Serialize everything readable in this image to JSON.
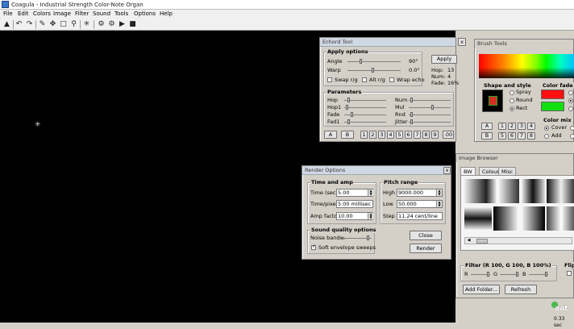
{
  "window": {
    "title": "Coagula - Industrial Strength Color-Note Organ"
  },
  "menu": [
    "File",
    "Edit",
    "Colors",
    "Image",
    "Filter",
    "Sound",
    "Tools",
    "Options",
    "Help"
  ],
  "toolbar_icons": [
    "save-icon",
    "undo-icon",
    "redo-icon",
    "pencil-icon",
    "move-icon",
    "crop-icon",
    "zoom-icon",
    "spray-icon",
    "settings-icon",
    "settings-icon",
    "play-icon",
    "stop-icon"
  ],
  "echord": {
    "title": "Echord Tool",
    "close": "x",
    "apply_group": "Apply options",
    "angle_label": "Angle",
    "angle_value": "90°",
    "warp_label": "Warp",
    "warp_value": "0.0°",
    "swap_label": "Swap r/g",
    "alt_label": "Alt r/g",
    "wrap_label": "Wrap echo",
    "apply_btn": "Apply",
    "hop_info": "Hop:",
    "hop_info_val": "13",
    "num_info": "Num:",
    "num_info_val": "4",
    "fade_info": "Fade:",
    "fade_info_val": "16%",
    "params_group": "Parameters",
    "params_left": [
      "Hop",
      "Hop1",
      "Fade",
      "Fad1"
    ],
    "params_right": [
      "Num",
      "Mul",
      "Rnd",
      "Jitter"
    ],
    "presets": [
      "A",
      "B",
      "1",
      "2",
      "3",
      "4",
      "5",
      "6",
      "7",
      "8",
      "9",
      ".00"
    ]
  },
  "brush": {
    "title": "Brush Tools",
    "shape_group": "Shape and style",
    "spray": "Spray",
    "round": "Round",
    "rect": "Rect",
    "colorfade_group": "Color fade",
    "colormix_group": "Color mix",
    "cover": "Cover",
    "add": "Add",
    "preset_row1": [
      "A",
      "1",
      "2",
      "3",
      "4"
    ],
    "preset_row2": [
      "B",
      "5",
      "6",
      "7",
      "8"
    ]
  },
  "render": {
    "title": "Render Options",
    "time_group": "Time and amp",
    "time_label": "Time (sec)",
    "time_value": "5.00",
    "tpp_label": "Time/pixel",
    "tpp_value": "5.00 millisec",
    "amp_label": "Amp factor",
    "amp_value": "10.00",
    "pitch_group": "Pitch range",
    "high_label": "High",
    "high_value": "9000.000",
    "low_label": "Low",
    "low_value": "50.000",
    "step_label": "Step",
    "step_value": "11.24 cent/line",
    "quality_group": "Sound quality options",
    "noise_label": "Noise bandw.",
    "soft_label": "Soft envelope sweeps",
    "close_btn": "Close",
    "render_btn": "Render"
  },
  "browser": {
    "title": "Image Browser",
    "tabs": [
      "BW",
      "Colour",
      "Misc"
    ],
    "filter_group": "Filter (R 100, G 100, B 100%)",
    "r": "R",
    "g": "G",
    "b": "B",
    "flip_group": "Flip",
    "add_folder": "Add Folder...",
    "refresh": "Refresh"
  },
  "status": {
    "time": "0.33 sec"
  },
  "watermark": "aat"
}
